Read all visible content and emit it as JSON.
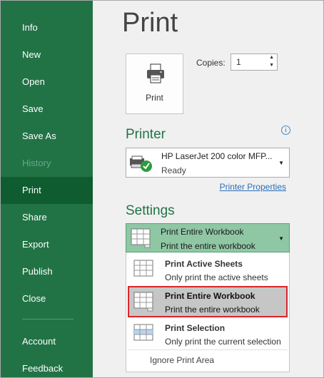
{
  "sidebar": {
    "items": [
      {
        "label": "Info"
      },
      {
        "label": "New"
      },
      {
        "label": "Open"
      },
      {
        "label": "Save"
      },
      {
        "label": "Save As"
      },
      {
        "label": "History"
      },
      {
        "label": "Print"
      },
      {
        "label": "Share"
      },
      {
        "label": "Export"
      },
      {
        "label": "Publish"
      },
      {
        "label": "Close"
      },
      {
        "label": "Account"
      },
      {
        "label": "Feedback"
      }
    ]
  },
  "main": {
    "title": "Print",
    "print_button_label": "Print",
    "copies_label": "Copies:",
    "copies_value": "1",
    "printer_section_title": "Printer",
    "printer_name": "HP LaserJet 200 color MFP...",
    "printer_status": "Ready",
    "printer_properties_link": "Printer Properties",
    "settings_section_title": "Settings",
    "settings_selected_title": "Print Entire Workbook",
    "settings_selected_desc": "Print the entire workbook",
    "dropdown_options": [
      {
        "title": "Print Active Sheets",
        "desc": "Only print the active sheets"
      },
      {
        "title": "Print Entire Workbook",
        "desc": "Print the entire workbook"
      },
      {
        "title": "Print Selection",
        "desc": "Only print the current selection"
      }
    ],
    "ignore_print_area": "Ignore Print Area",
    "info_icon": "i"
  },
  "colors": {
    "sidebar_bg": "#217346",
    "sidebar_active": "#0e5c30",
    "accent_text": "#217346",
    "link": "#2a6ebb",
    "selected_highlight_border": "#d9262a"
  }
}
